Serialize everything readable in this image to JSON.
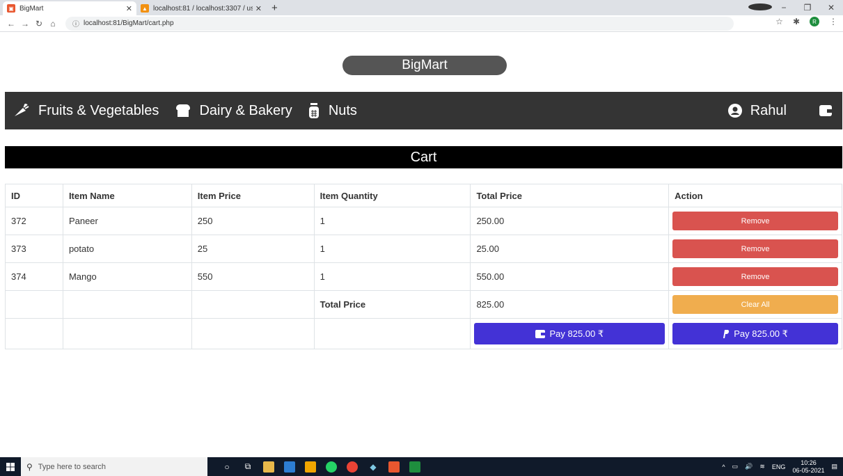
{
  "browser": {
    "tabs": [
      {
        "title": "BigMart",
        "active": true
      },
      {
        "title": "localhost:81 / localhost:3307 / us",
        "active": false
      }
    ],
    "new_tab": "+",
    "url": "localhost:81/BigMart/cart.php"
  },
  "brand": "BigMart",
  "nav": {
    "items": [
      {
        "label": "Fruits & Vegetables",
        "icon": "carrot-icon"
      },
      {
        "label": "Dairy & Bakery",
        "icon": "bread-icon"
      },
      {
        "label": "Nuts",
        "icon": "jar-icon"
      }
    ],
    "user": "Rahul"
  },
  "cart": {
    "title": "Cart",
    "headers": [
      "ID",
      "Item Name",
      "Item Price",
      "Item Quantity",
      "Total Price",
      "Action"
    ],
    "rows": [
      {
        "id": "372",
        "name": "Paneer",
        "price": "250",
        "qty": "1",
        "total": "250.00"
      },
      {
        "id": "373",
        "name": "potato",
        "price": "25",
        "qty": "1",
        "total": "25.00"
      },
      {
        "id": "374",
        "name": "Mango",
        "price": "550",
        "qty": "1",
        "total": "550.00"
      }
    ],
    "remove_label": "Remove",
    "total_label": "Total Price",
    "total_value": "825.00",
    "clear_label": "Clear All",
    "pay_wallet_label": "Pay 825.00 ₹",
    "pay_paypal_label": "Pay 825.00 ₹"
  },
  "taskbar": {
    "search_placeholder": "Type here to search",
    "lang": "ENG",
    "time": "10:26",
    "date": "06-05-2021"
  },
  "colors": {
    "navbar": "#343434",
    "remove": "#d9534f",
    "clear": "#f0ad4e",
    "pay": "#4332d6"
  }
}
